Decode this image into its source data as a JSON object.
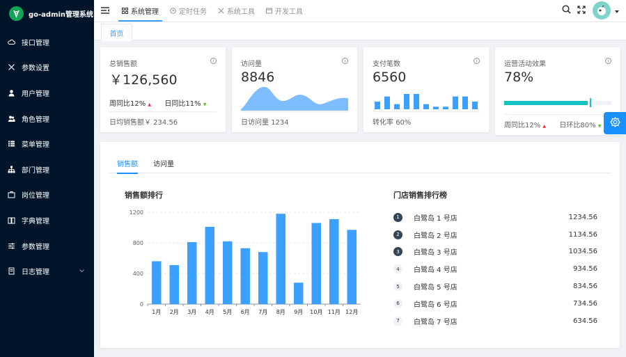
{
  "app": {
    "title": "go-admin管理系统"
  },
  "sidebar": {
    "items": [
      {
        "label": "接口管理",
        "icon": "cloud-icon"
      },
      {
        "label": "参数设置",
        "icon": "tools-icon"
      },
      {
        "label": "用户管理",
        "icon": "user-icon"
      },
      {
        "label": "角色管理",
        "icon": "peoples-icon"
      },
      {
        "label": "菜单管理",
        "icon": "tree-table-icon"
      },
      {
        "label": "部门管理",
        "icon": "tree-icon"
      },
      {
        "label": "岗位管理",
        "icon": "post-icon"
      },
      {
        "label": "字典管理",
        "icon": "education-icon"
      },
      {
        "label": "参数管理",
        "icon": "sliders-icon"
      },
      {
        "label": "日志管理",
        "icon": "log-icon"
      }
    ]
  },
  "topnav": {
    "tabs": [
      {
        "label": "系统管理",
        "icon": "grid-icon"
      },
      {
        "label": "定时任务",
        "icon": "clock-icon"
      },
      {
        "label": "系统工具",
        "icon": "tools-icon"
      },
      {
        "label": "开发工具",
        "icon": "dev-icon"
      }
    ]
  },
  "tags": {
    "home": "首页"
  },
  "cards": {
    "sales": {
      "title": "总销售额",
      "value": "￥126,560",
      "week_label": "周同比",
      "week_value": "12%",
      "day_label": "日同比",
      "day_value": "11%",
      "footer_label": "日均销售额",
      "footer_value": "￥ 234.56"
    },
    "visits": {
      "title": "访问量",
      "value": "8846",
      "footer_label": "日访问量",
      "footer_value": "1234"
    },
    "payments": {
      "title": "支付笔数",
      "value": "6560",
      "footer_label": "转化率",
      "footer_value": "60%",
      "bars": [
        3,
        5,
        2,
        6,
        6,
        2,
        1,
        1,
        5,
        5,
        3
      ]
    },
    "ops": {
      "title": "运营活动效果",
      "value": "78%",
      "progress": 0.78,
      "week_label": "周同比",
      "week_value": "12%",
      "ring_label": "日环比",
      "ring_value": "80%"
    }
  },
  "panel": {
    "tabs": [
      "销售额",
      "访问量"
    ],
    "chart_title": "销售额排行",
    "ranking_title": "门店销售排行榜",
    "ranking": [
      {
        "rank": "1",
        "name": "白鹭岛 1 号店",
        "value": "1234.56"
      },
      {
        "rank": "2",
        "name": "白鹭岛 2 号店",
        "value": "1134.56"
      },
      {
        "rank": "3",
        "name": "白鹭岛 3 号店",
        "value": "1034.56"
      },
      {
        "rank": "4",
        "name": "白鹭岛 4 号店",
        "value": "934.56"
      },
      {
        "rank": "5",
        "name": "白鹭岛 5 号店",
        "value": "834.56"
      },
      {
        "rank": "6",
        "name": "白鹭岛 6 号店",
        "value": "734.56"
      },
      {
        "rank": "7",
        "name": "白鹭岛 7 号店",
        "value": "634.56"
      }
    ]
  },
  "colors": {
    "sidebar_bg": "#001529",
    "accent": "#1890ff",
    "bar": "#3ba0ff",
    "progress": "#13c2c2"
  },
  "chart_data": {
    "type": "bar",
    "title": "销售额排行",
    "categories": [
      "1月",
      "2月",
      "3月",
      "4月",
      "5月",
      "6月",
      "7月",
      "8月",
      "9月",
      "10月",
      "11月",
      "12月"
    ],
    "values": [
      560,
      510,
      810,
      1010,
      820,
      730,
      680,
      1180,
      280,
      1060,
      1110,
      970
    ],
    "yticks": [
      0,
      400,
      800,
      1200
    ],
    "ylim": [
      0,
      1200
    ],
    "grid": true
  }
}
